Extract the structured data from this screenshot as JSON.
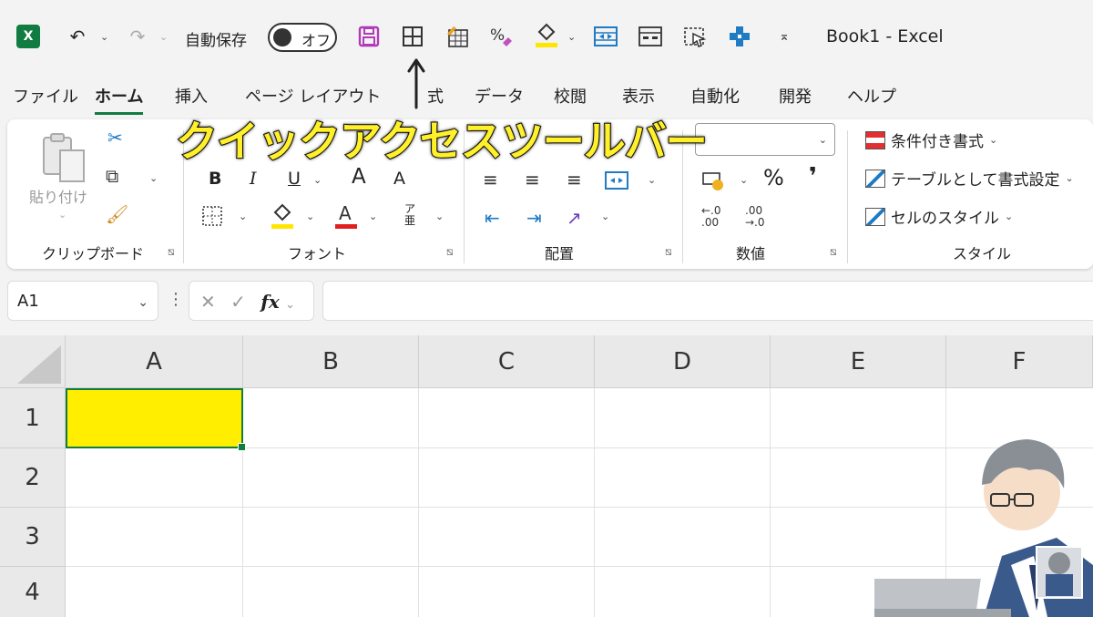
{
  "qat": {
    "autosave_label": "自動保存",
    "autosave_state": "オフ",
    "book_title": "Book1  -  Excel",
    "app_logo": "X",
    "icons": [
      "undo-icon",
      "redo-icon",
      "save-icon",
      "borders-icon",
      "table-icon",
      "percent-icon",
      "fill-color-icon",
      "merge-center-icon",
      "format-cells-icon",
      "screenshot-icon",
      "drag-cross-icon",
      "customize-qat-icon"
    ]
  },
  "tabs": [
    "ファイル",
    "ホーム",
    "挿入",
    "ページ レイアウト",
    "式",
    "データ",
    "校閲",
    "表示",
    "自動化",
    "開発",
    "ヘルプ"
  ],
  "active_tab": "ホーム",
  "ribbon": {
    "groups": {
      "clipboard": "クリップボード",
      "font": "フォント",
      "alignment": "配置",
      "number": "数値",
      "styles": "スタイル"
    },
    "paste_label": "貼り付け",
    "bold": "B",
    "italic": "I",
    "underline": "U",
    "grow_font": "A",
    "shrink_font": "A",
    "phonetic": "ア亜",
    "styles_items": [
      "条件付き書式",
      "テーブルとして書式設定",
      "セルのスタイル"
    ],
    "percent": "%",
    "comma": "❜",
    "inc_decimal": "←.0 .00",
    "dec_decimal": ".00 →.0"
  },
  "callout": "クイックアクセスツールバー",
  "formula_bar": {
    "name_box": "A1",
    "fx": "fx",
    "formula": ""
  },
  "sheet": {
    "columns": [
      "A",
      "B",
      "C",
      "D",
      "E",
      "F"
    ],
    "rows": [
      "1",
      "2",
      "3",
      "4"
    ],
    "selected_fill": "#ffee00",
    "accent": "#107c41"
  }
}
